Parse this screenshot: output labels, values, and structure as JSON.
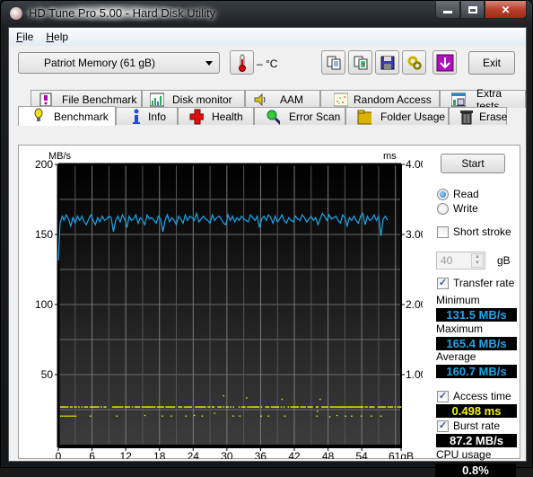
{
  "window": {
    "title": "HD Tune Pro 5.00 - Hard Disk Utility",
    "controls": {
      "minimize": "—",
      "maximize": "▫",
      "close": "✕"
    }
  },
  "menu": [
    {
      "label": "File",
      "accel": "F",
      "rest": "ile"
    },
    {
      "label": "Help",
      "accel": "H",
      "rest": "elp"
    }
  ],
  "toolbar": {
    "drive": "Patriot Memory   (61 gB)",
    "temperature": "– °C",
    "icons": [
      "thermometer-icon",
      "copy-text-icon",
      "copy-screenshot-icon",
      "save-icon",
      "options-icon",
      "download-icon"
    ],
    "exit_label": "Exit"
  },
  "tabs_top": [
    {
      "label": "File Benchmark",
      "icon": "file-benchmark-icon"
    },
    {
      "label": "Disk monitor",
      "icon": "disk-monitor-icon"
    },
    {
      "label": "AAM",
      "icon": "speaker-icon"
    },
    {
      "label": "Random Access",
      "icon": "random-access-icon"
    },
    {
      "label": "Extra tests",
      "icon": "extra-tests-icon"
    }
  ],
  "tabs_bottom": [
    {
      "label": "Benchmark",
      "icon": "lightbulb-icon",
      "active": true
    },
    {
      "label": "Info",
      "icon": "info-icon"
    },
    {
      "label": "Health",
      "icon": "health-cross-icon"
    },
    {
      "label": "Error Scan",
      "icon": "magnifier-icon"
    },
    {
      "label": "Folder Usage",
      "icon": "folder-icon"
    },
    {
      "label": "Erase",
      "icon": "trash-icon"
    }
  ],
  "side": {
    "start_label": "Start",
    "read_label": "Read",
    "write_label": "Write",
    "mode_selected": "Read",
    "short_stroke_label": "Short stroke",
    "short_stroke_checked": false,
    "short_stroke_value": "40",
    "short_stroke_unit": "gB",
    "transfer_rate_label": "Transfer rate",
    "transfer_rate_checked": true,
    "minimum_label": "Minimum",
    "minimum_value": "131.5 MB/s",
    "maximum_label": "Maximum",
    "maximum_value": "165.4 MB/s",
    "average_label": "Average",
    "average_value": "160.7 MB/s",
    "access_time_label": "Access time",
    "access_time_checked": true,
    "access_time_value": "0.498 ms",
    "burst_rate_label": "Burst rate",
    "burst_rate_checked": true,
    "burst_rate_value": "87.2 MB/s",
    "cpu_label": "CPU usage",
    "cpu_value": "0.8%",
    "colors": {
      "rate_text": "#1aa7ec",
      "access_text": "#f5f500",
      "white_text": "#ffffff"
    }
  },
  "chart_data": {
    "type": "line",
    "title": "",
    "left_axis_label": "MB/s",
    "right_axis_label": "ms",
    "xlabel": "gB",
    "left_ylim": [
      0,
      200
    ],
    "right_ylim": [
      0,
      4
    ],
    "xlim": [
      0,
      61
    ],
    "left_ticks": [
      "200",
      "150",
      "100",
      "50"
    ],
    "left_tick_values": [
      200,
      150,
      100,
      50
    ],
    "right_ticks": [
      "4.00",
      "3.00",
      "2.00",
      "1.00"
    ],
    "right_tick_values": [
      4,
      3,
      2,
      1
    ],
    "x_ticks": [
      "0",
      "6",
      "12",
      "18",
      "24",
      "30",
      "36",
      "42",
      "48",
      "54",
      "61gB"
    ],
    "x_tick_values": [
      0,
      6,
      12,
      18,
      24,
      30,
      36,
      42,
      48,
      54,
      61
    ],
    "grid": true,
    "series": [
      {
        "name": "Transfer rate (MB/s)",
        "color": "#1aa7ec",
        "axis": "left",
        "x": [
          0,
          0.3,
          0.7,
          1,
          1.4,
          1.8,
          2.2,
          2.6,
          3,
          3.4,
          3.8,
          4.2,
          4.6,
          5,
          5.4,
          5.8,
          6.2,
          6.6,
          7,
          7.4,
          7.8,
          8.2,
          8.6,
          9,
          9.4,
          9.8,
          10.2,
          10.6,
          11,
          11.4,
          11.8,
          12.2,
          12.6,
          13,
          13.4,
          13.8,
          14.2,
          14.6,
          15,
          15.4,
          15.8,
          16.2,
          16.6,
          17,
          17.4,
          17.8,
          18.2,
          18.6,
          19,
          19.4,
          19.8,
          20.2,
          20.6,
          21,
          21.4,
          21.8,
          22.2,
          22.6,
          23,
          23.4,
          23.8,
          24.2,
          24.6,
          25,
          25.4,
          25.8,
          26.2,
          26.6,
          27,
          27.4,
          27.8,
          28.2,
          28.6,
          29,
          29.4,
          29.8,
          30.2,
          30.6,
          31,
          31.4,
          31.8,
          32.2,
          32.6,
          33,
          33.4,
          33.8,
          34.2,
          34.6,
          35,
          35.4,
          35.8,
          36.2,
          36.6,
          37,
          37.4,
          37.8,
          38.2,
          38.6,
          39,
          39.4,
          39.8,
          40.2,
          40.6,
          41,
          41.4,
          41.8,
          42.2,
          42.6,
          43,
          43.4,
          43.8,
          44.2,
          44.6,
          45,
          45.4,
          45.8,
          46.2,
          46.6,
          47,
          47.4,
          47.8,
          48.2,
          48.6,
          49,
          49.4,
          49.8,
          50.2,
          50.6,
          51,
          51.4,
          51.8,
          52.2,
          52.6,
          53,
          53.4,
          53.8,
          54.2,
          54.6,
          55,
          55.4,
          55.8,
          56.2,
          56.6,
          57,
          57.4,
          57.8,
          58.2,
          58.6,
          59,
          59.4,
          59.8,
          60.2,
          60.6,
          61
        ],
        "values": [
          131.5,
          158,
          163,
          160,
          164,
          161,
          156,
          162,
          158,
          163,
          160,
          163,
          159,
          157,
          161,
          164,
          160,
          157,
          162,
          159,
          163,
          160,
          161,
          163,
          162,
          152,
          160,
          163,
          159,
          164,
          161,
          155,
          163,
          160,
          161,
          164,
          158,
          162,
          160,
          157,
          164,
          161,
          162,
          160,
          158,
          163,
          161,
          152,
          160,
          164,
          159,
          162,
          160,
          157,
          163,
          161,
          158,
          164,
          160,
          163,
          162,
          160,
          165,
          159,
          161,
          163,
          161,
          160,
          158,
          164,
          160,
          162,
          163,
          161,
          158,
          157,
          164,
          160,
          163,
          159,
          162,
          160,
          163,
          161,
          160,
          159,
          164,
          162,
          160,
          163,
          155,
          161,
          163,
          160,
          164,
          162,
          158,
          163,
          159,
          161,
          164,
          160,
          158,
          162,
          160,
          159,
          163,
          161,
          160,
          164,
          162,
          159,
          161,
          163,
          160,
          162,
          157,
          161,
          165,
          163,
          160,
          164,
          161,
          162,
          163,
          160,
          158,
          164,
          162,
          156,
          162,
          160,
          163,
          160,
          158,
          163,
          165,
          157,
          163,
          160,
          161,
          164,
          160,
          163,
          149,
          161,
          163,
          160
        ],
        "min": 131.5,
        "max": 165.4,
        "average": 160.7
      },
      {
        "name": "Access time (ms)",
        "color": "#f5f500",
        "axis": "right",
        "type": "scatter",
        "primary_band_ms": 0.54,
        "secondary_band_ms": 0.41,
        "outliers": [
          [
            5.6,
            0.41
          ],
          [
            10.3,
            0.41
          ],
          [
            15.3,
            0.42
          ],
          [
            18.4,
            0.41
          ],
          [
            20.0,
            0.41
          ],
          [
            22.6,
            0.41
          ],
          [
            24.1,
            0.42
          ],
          [
            25.5,
            0.41
          ],
          [
            27.7,
            0.45
          ],
          [
            29.3,
            0.7
          ],
          [
            31.0,
            0.41
          ],
          [
            32.2,
            0.41
          ],
          [
            33.4,
            0.67
          ],
          [
            36.0,
            0.41
          ],
          [
            37.3,
            0.41
          ],
          [
            39.7,
            0.65
          ],
          [
            40.2,
            0.41
          ],
          [
            45.9,
            0.41
          ],
          [
            46.5,
            0.65
          ],
          [
            46.0,
            0.48
          ],
          [
            48.2,
            0.4
          ],
          [
            49.5,
            0.42
          ],
          [
            51.0,
            0.41
          ],
          [
            52.1,
            0.41
          ],
          [
            53.8,
            0.41
          ],
          [
            55.6,
            0.41
          ],
          [
            57.3,
            0.41
          ]
        ]
      }
    ]
  }
}
